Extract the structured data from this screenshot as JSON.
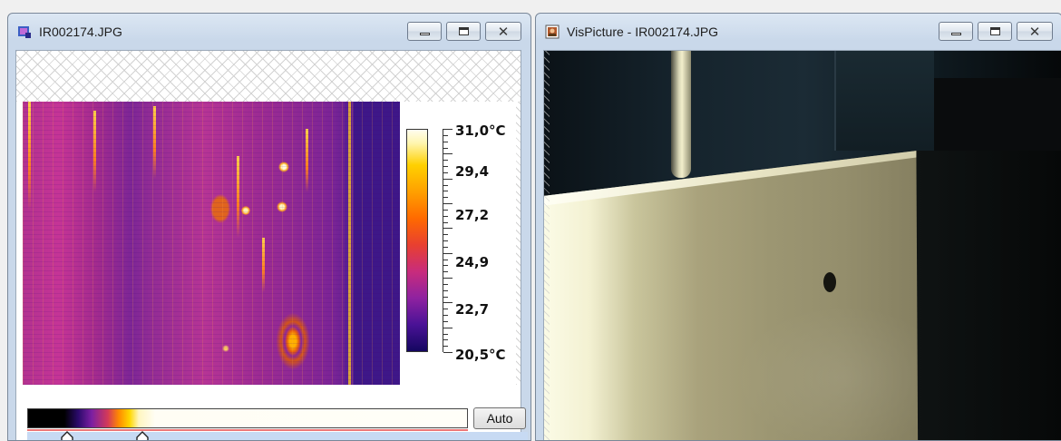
{
  "ir_window": {
    "title": "IR002174.JPG",
    "icon": "thermal-image-icon",
    "controls": {
      "minimize": "minimize-icon",
      "maximize": "maximize-icon",
      "close": "close-icon"
    },
    "scale": {
      "max_label": "31,0°C",
      "labels": [
        "29,4",
        "27,2",
        "24,9",
        "22,7"
      ],
      "min_label": "20,5°C"
    },
    "palette": {
      "auto_button": "Auto",
      "thumb_low_percent": 8,
      "thumb_high_percent": 23
    }
  },
  "vis_window": {
    "title": "VisPicture - IR002174.JPG",
    "icon": "camera-picture-icon",
    "controls": {
      "minimize": "minimize-icon",
      "maximize": "maximize-icon",
      "close": "close-icon"
    }
  },
  "colors": {
    "titlebar": "#c9d8ea",
    "palette_line": "#ee7777",
    "slider_track": "#c7daf3"
  }
}
